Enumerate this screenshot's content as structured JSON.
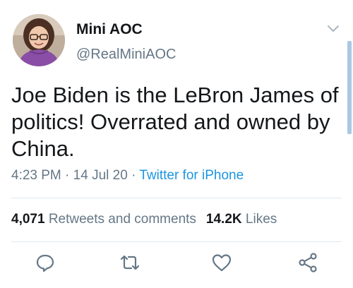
{
  "user": {
    "display_name": "Mini AOC",
    "handle": "@RealMiniAOC",
    "avatar_icon": "profile-photo"
  },
  "tweet": {
    "text": "Joe Biden is the LeBron James of politics! Overrated and owned by China.",
    "time": "4:23 PM",
    "date": "14 Jul 20",
    "separator": "·",
    "source": "Twitter for iPhone"
  },
  "stats": {
    "retweets_count": "4,071",
    "retweets_label": "Retweets and comments",
    "likes_count": "14.2K",
    "likes_label": "Likes"
  },
  "actions": [
    {
      "name": "reply",
      "icon": "speech-bubble-icon"
    },
    {
      "name": "retweet",
      "icon": "retweet-arrows-icon"
    },
    {
      "name": "like",
      "icon": "heart-icon"
    },
    {
      "name": "share",
      "icon": "share-icon"
    }
  ],
  "colors": {
    "text": "#14171a",
    "secondary": "#657786",
    "link": "#1b95e0",
    "divider": "#e1e8ed"
  }
}
